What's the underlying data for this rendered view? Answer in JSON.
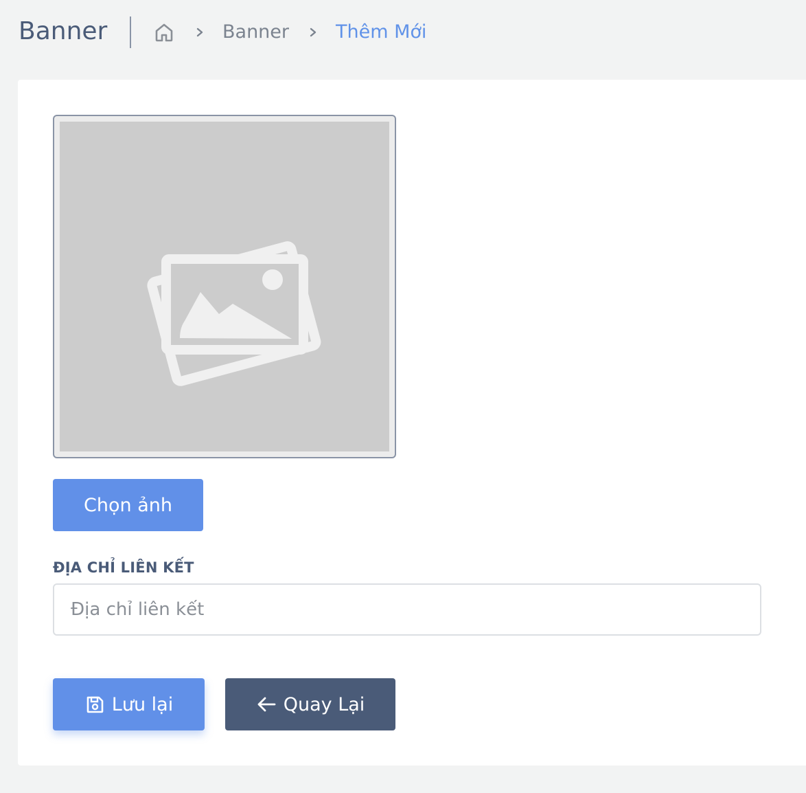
{
  "header": {
    "title": "Banner",
    "breadcrumb": [
      {
        "icon": "home-icon"
      },
      {
        "label": "Banner"
      },
      {
        "label": "Thêm Mới"
      }
    ]
  },
  "form": {
    "image": {
      "placeholder_icon": "image-placeholder-icon"
    },
    "choose_image_label": "Chọn ảnh",
    "link_field": {
      "label": "ĐỊA CHỈ LIÊN KẾT",
      "value": "",
      "placeholder": "Địa chỉ liên kết"
    },
    "actions": {
      "save_label": "Lưu lại",
      "save_icon": "save-icon",
      "back_label": "Quay Lại",
      "back_icon": "arrow-left-icon"
    }
  },
  "colors": {
    "primary": "#6190e8",
    "secondary": "#4a5b78",
    "breadcrumb_active": "#6092e8",
    "background": "#f2f3f3"
  }
}
